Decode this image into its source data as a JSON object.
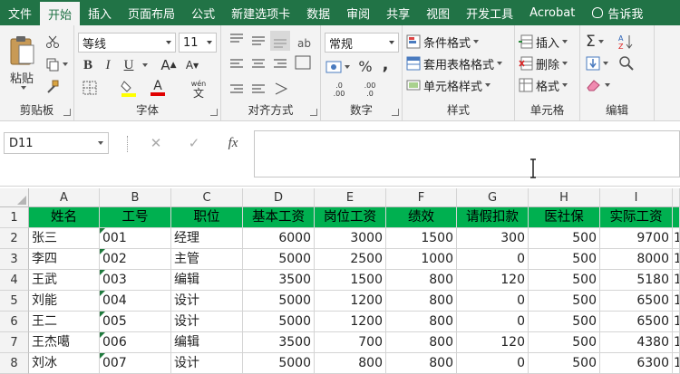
{
  "menubar": {
    "tabs": [
      "文件",
      "开始",
      "插入",
      "页面布局",
      "公式",
      "新建选项卡",
      "数据",
      "审阅",
      "共享",
      "视图",
      "开发工具",
      "Acrobat"
    ],
    "active_index": 1,
    "tell_me": "告诉我"
  },
  "ribbon": {
    "clipboard": {
      "paste": "粘贴",
      "label": "剪贴板"
    },
    "font": {
      "name": "等线",
      "size": "11",
      "bold": "B",
      "italic": "I",
      "underline": "U",
      "grow": "A",
      "shrink": "A",
      "font_color": "A",
      "wen": "wén",
      "wen2": "文",
      "label": "字体"
    },
    "alignment": {
      "label": "对齐方式"
    },
    "number": {
      "format": "常规",
      "percent": "%",
      "comma": ",",
      "label": "数字"
    },
    "styles": {
      "conditional": "条件格式",
      "table": "套用表格格式",
      "cell": "单元格样式",
      "label": "样式"
    },
    "cells": {
      "insert": "插入",
      "delete": "删除",
      "format": "格式",
      "label": "单元格"
    },
    "editing": {
      "sum": "Σ",
      "label": "编辑"
    }
  },
  "formula_bar": {
    "name_box": "D11",
    "cancel": "✕",
    "confirm": "✓",
    "fx": "fx",
    "value": ""
  },
  "sheet": {
    "columns": [
      "A",
      "B",
      "C",
      "D",
      "E",
      "F",
      "G",
      "H",
      "I"
    ],
    "rows": [
      "1",
      "2",
      "3",
      "4",
      "5",
      "6",
      "7",
      "8"
    ],
    "header": [
      "姓名",
      "工号",
      "职位",
      "基本工资",
      "岗位工资",
      "绩效",
      "请假扣款",
      "医社保",
      "实际工资"
    ],
    "data": [
      [
        "张三",
        "001",
        "经理",
        "6000",
        "3000",
        "1500",
        "300",
        "500",
        "9700"
      ],
      [
        "李四",
        "002",
        "主管",
        "5000",
        "2500",
        "1000",
        "0",
        "500",
        "8000"
      ],
      [
        "王武",
        "003",
        "编辑",
        "3500",
        "1500",
        "800",
        "120",
        "500",
        "5180"
      ],
      [
        "刘能",
        "004",
        "设计",
        "5000",
        "1200",
        "800",
        "0",
        "500",
        "6500"
      ],
      [
        "王二",
        "005",
        "设计",
        "5000",
        "1200",
        "800",
        "0",
        "500",
        "6500"
      ],
      [
        "王杰噶",
        "006",
        "编辑",
        "3500",
        "700",
        "800",
        "120",
        "500",
        "4380"
      ],
      [
        "刘冰",
        "007",
        "设计",
        "5000",
        "800",
        "800",
        "0",
        "500",
        "6300"
      ]
    ],
    "next_column_partial": [
      "",
      "1",
      "1",
      "1",
      "1",
      "1",
      "1",
      "1"
    ]
  },
  "colors": {
    "excel_green": "#217346",
    "header_fill": "#00b050"
  }
}
